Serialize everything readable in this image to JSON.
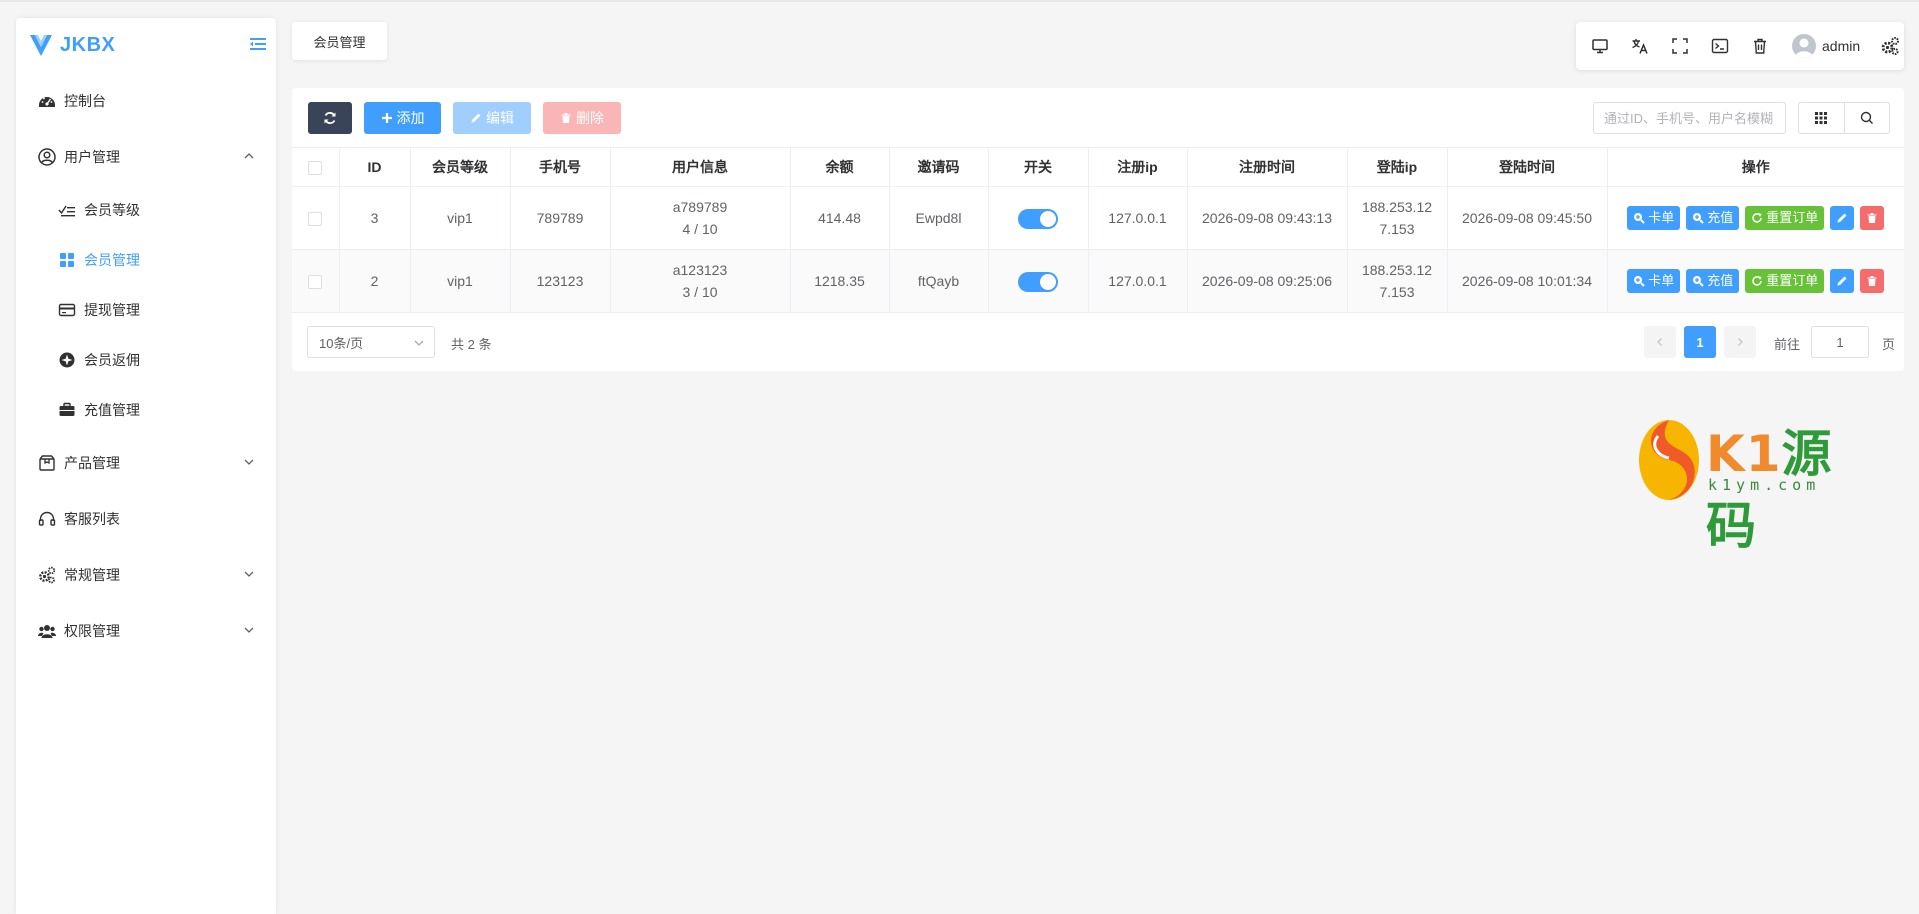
{
  "app": {
    "brand": "JKBX",
    "user": "admin"
  },
  "breadcrumb": {
    "current": "会员管理"
  },
  "sidebar": {
    "items": [
      {
        "label": "控制台"
      },
      {
        "label": "用户管理",
        "children": [
          {
            "label": "会员等级"
          },
          {
            "label": "会员管理"
          },
          {
            "label": "提现管理"
          },
          {
            "label": "会员返佣"
          },
          {
            "label": "充值管理"
          }
        ]
      },
      {
        "label": "产品管理"
      },
      {
        "label": "客服列表"
      },
      {
        "label": "常规管理"
      },
      {
        "label": "权限管理"
      }
    ]
  },
  "toolbar": {
    "add_label": "添加",
    "edit_label": "编辑",
    "delete_label": "删除",
    "search_placeholder": "通过ID、手机号、用户名模糊"
  },
  "table": {
    "headers": [
      "ID",
      "会员等级",
      "手机号",
      "用户信息",
      "余额",
      "邀请码",
      "开关",
      "注册ip",
      "注册时间",
      "登陆ip",
      "登陆时间",
      "操作"
    ],
    "rows": [
      {
        "id": "3",
        "level": "vip1",
        "phone": "789789",
        "user": "a789789",
        "user_sub": "4 / 10",
        "balance": "414.48",
        "invite": "Ewpd8l",
        "switch_on": true,
        "reg_ip": "127.0.0.1",
        "reg_time": "2026-09-08 09:43:13",
        "login_ip_1": "188.253.12",
        "login_ip_2": "7.153",
        "login_time": "2026-09-08 09:45:50"
      },
      {
        "id": "2",
        "level": "vip1",
        "phone": "123123",
        "user": "a123123",
        "user_sub": "3 / 10",
        "balance": "1218.35",
        "invite": "ftQayb",
        "switch_on": true,
        "reg_ip": "127.0.0.1",
        "reg_time": "2026-09-08 09:25:06",
        "login_ip_1": "188.253.12",
        "login_ip_2": "7.153",
        "login_time": "2026-09-08 10:01:34"
      }
    ],
    "row_actions": {
      "card": "卡单",
      "recharge": "充值",
      "reset": "重置订单"
    }
  },
  "pagination": {
    "page_size": "10条/页",
    "total": "共 2 条",
    "current": "1",
    "goto_label": "前往",
    "goto_value": "1",
    "goto_suffix": "页"
  },
  "watermark": {
    "main": "K1",
    "main_cn": "源码",
    "sub": "k1ym.com"
  },
  "colors": {
    "primary": "#409eff",
    "success": "#67c23a",
    "danger": "#f56c6c",
    "dark": "#3a4459"
  }
}
